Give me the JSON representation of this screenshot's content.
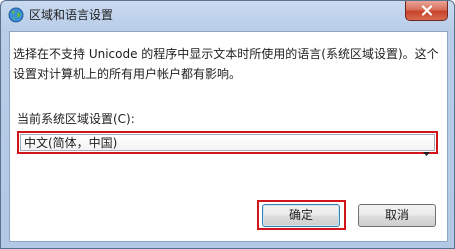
{
  "window": {
    "title": "区域和语言设置",
    "icon": "globe-icon",
    "close_icon": "close-icon"
  },
  "dialog": {
    "description": "选择在不支持 Unicode 的程序中显示文本时所使用的语言(系统区域设置)。这个设置对计算机上的所有用户帐户都有影响。",
    "locale_label": "当前系统区域设置(C):",
    "locale_value": "中文(简体，中国)",
    "ok_label": "确定",
    "cancel_label": "取消"
  },
  "colors": {
    "highlight": "#d0151b",
    "close_button": "#c8432a"
  }
}
